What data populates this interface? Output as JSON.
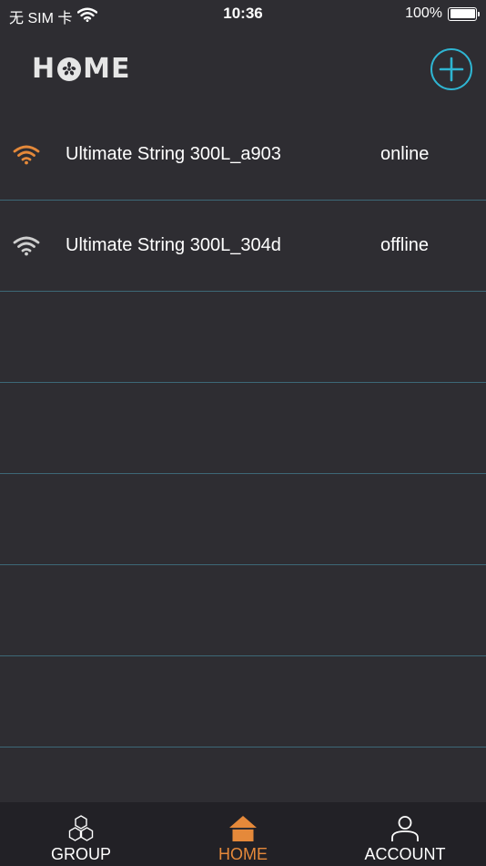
{
  "status_bar": {
    "carrier": "无 SIM 卡",
    "time": "10:36",
    "battery": "100%",
    "battery_level": 1.0
  },
  "header": {
    "logo_left": "H",
    "logo_right": "ME",
    "add_icon": "plus-circle-icon"
  },
  "devices": [
    {
      "name": "Ultimate String 300L_a903",
      "status": "online",
      "icon": "wifi-icon",
      "icon_color": "#e5893a"
    },
    {
      "name": "Ultimate String 300L_304d",
      "status": "offline",
      "icon": "wifi-icon",
      "icon_color": "#cfcfcf"
    }
  ],
  "tabs": [
    {
      "label": "GROUP",
      "icon": "group-hexagon-icon"
    },
    {
      "label": "HOME",
      "icon": "home-icon",
      "active": true
    },
    {
      "label": "ACCOUNT",
      "icon": "user-icon"
    }
  ],
  "colors": {
    "background": "#2e2d32",
    "tab_bar": "#222126",
    "accent": "#e5893a",
    "add_button": "#2fb5d2",
    "divider": "#3d6877"
  }
}
